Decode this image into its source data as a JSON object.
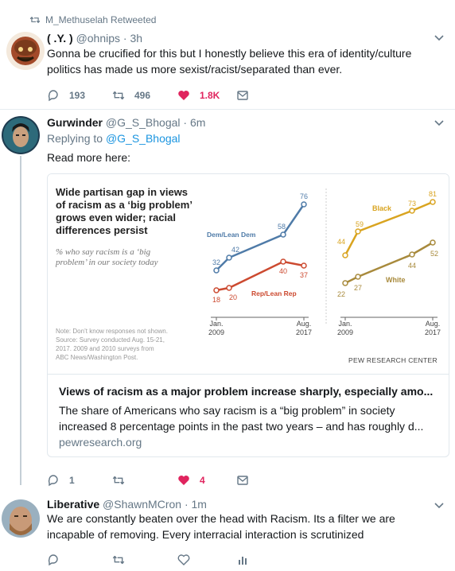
{
  "tweet1": {
    "retweet_context": "M_Methuselah Retweeted",
    "name": "( .Y. )",
    "handle": "@ohnips",
    "separator": "·",
    "time": "3h",
    "text": "Gonna be crucified for this but I honestly believe this era of identity/culture politics has made us more sexist/racist/separated than ever.",
    "replies": "193",
    "retweets": "496",
    "likes": "1.8K"
  },
  "tweet2": {
    "name": "Gurwinder",
    "handle": "@G_S_Bhogal",
    "separator": "·",
    "time": "6m",
    "replying_label": "Replying to",
    "replying_handle": "@G_S_Bhogal",
    "text": "Read more here:",
    "card": {
      "title": "Views of racism as a major problem increase sharply, especially amo...",
      "description": "The share of Americans who say racism is a “big problem” in society increased 8 percentage points in the past two years – and has roughly d...",
      "domain": "pewresearch.org"
    },
    "replies": "1",
    "retweets": "",
    "likes": "4"
  },
  "tweet3": {
    "name": "Liberative",
    "handle": "@ShawnMCron",
    "separator": "·",
    "time": "1m",
    "text": "We are constantly beaten over the head with Racism. Its a filter we are incapable of removing. Every interracial interaction is scrutinized"
  },
  "chart_data": [
    {
      "type": "line",
      "title": "Wide partisan gap in views of racism as a ‘big problem’ grows even wider; racial differences persist",
      "subtitle": "% who say racism is a ‘big problem’ in our society today",
      "x": [
        "Jan. 2009",
        "",
        "",
        "",
        "Aug. 2017"
      ],
      "x_tick_labels": [
        [
          "Jan.",
          "2009"
        ],
        [
          "Aug.",
          "2017"
        ]
      ],
      "series": [
        {
          "name": "Dem/Lean Dem",
          "color": "#4f7ba8",
          "values": [
            32,
            42,
            null,
            58,
            76
          ]
        },
        {
          "name": "Rep/Lean Rep",
          "color": "#cc4a30",
          "values": [
            18,
            20,
            null,
            40,
            37
          ]
        }
      ],
      "note": "Note: Don’t know responses not shown. Source: Survey conducted Aug. 15-21, 2017. 2009 and 2010 surveys from ABC News/Washington Post."
    },
    {
      "type": "line",
      "x": [
        "Jan. 2009",
        "",
        "",
        "",
        "Aug. 2017"
      ],
      "x_tick_labels": [
        [
          "Jan.",
          "2009"
        ],
        [
          "Aug.",
          "2017"
        ]
      ],
      "series": [
        {
          "name": "Black",
          "color": "#d9a420",
          "values": [
            44,
            59,
            null,
            73,
            81
          ]
        },
        {
          "name": "White",
          "color": "#a88a3c",
          "values": [
            22,
            27,
            null,
            44,
            52
          ]
        }
      ],
      "source": "PEW RESEARCH CENTER"
    }
  ],
  "colors": {
    "like_red": "#e0245e",
    "link_blue": "#1b95e0",
    "muted": "#657786"
  }
}
